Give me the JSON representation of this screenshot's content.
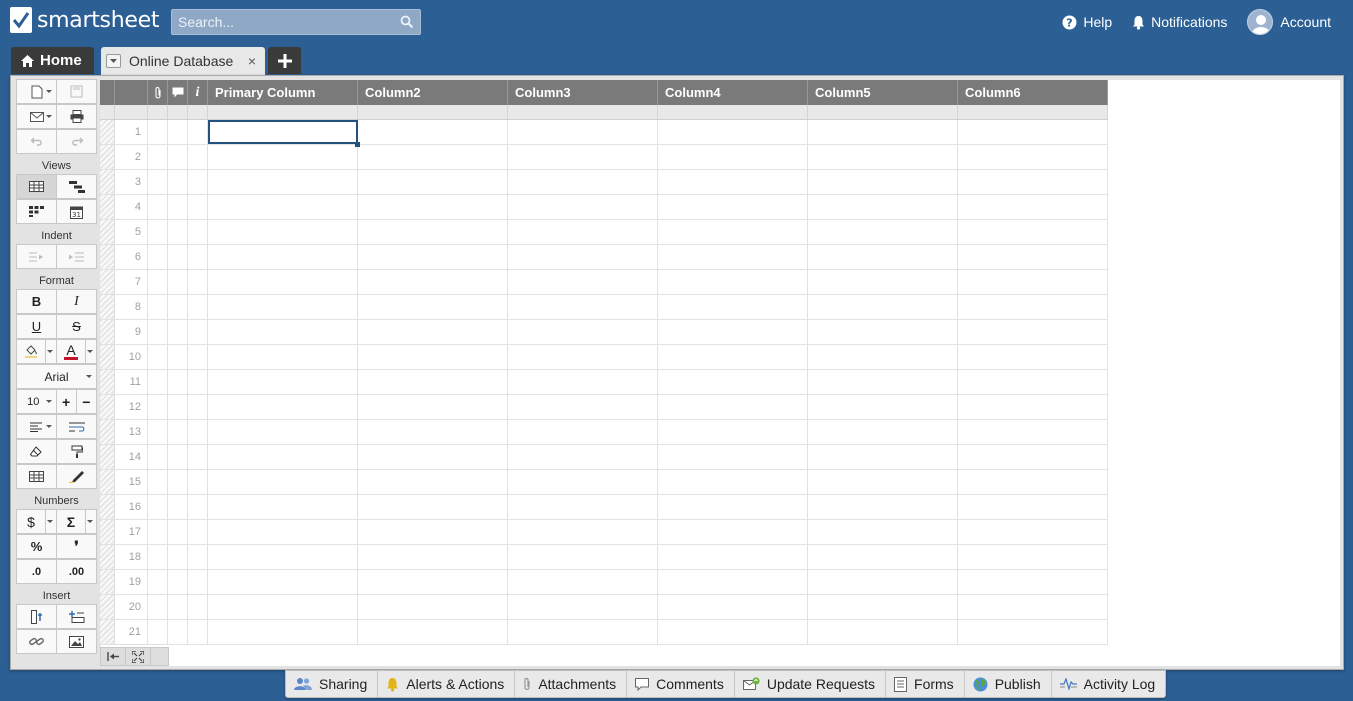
{
  "app": {
    "logo_text": "smartsheet"
  },
  "search": {
    "placeholder": "Search..."
  },
  "top_links": {
    "help": "Help",
    "notifications": "Notifications",
    "account": "Account"
  },
  "tabs": {
    "home": "Home",
    "sheet": "Online Database",
    "close": "×"
  },
  "toolbar": {
    "views_label": "Views",
    "indent_label": "Indent",
    "format_label": "Format",
    "numbers_label": "Numbers",
    "insert_label": "Insert",
    "bold": "B",
    "italic": "I",
    "underline": "U",
    "strike": "S",
    "text_color": "A",
    "font": "Arial",
    "font_size": "10",
    "size_up": "+",
    "size_down": "−",
    "currency": "$",
    "sum": "Σ",
    "percent": "%",
    "comma": "❜",
    "dec_less": ".0",
    "dec_more": ".00"
  },
  "grid": {
    "columns": [
      "Primary Column",
      "Column2",
      "Column3",
      "Column4",
      "Column5",
      "Column6"
    ],
    "info_header": "i",
    "rows": [
      "1",
      "2",
      "3",
      "4",
      "5",
      "6",
      "7",
      "8",
      "9",
      "10",
      "11",
      "12",
      "13",
      "14",
      "15",
      "16",
      "17",
      "18",
      "19",
      "20",
      "21"
    ]
  },
  "bottombar": {
    "sharing": "Sharing",
    "alerts": "Alerts & Actions",
    "attachments": "Attachments",
    "comments": "Comments",
    "update_requests": "Update Requests",
    "forms": "Forms",
    "publish": "Publish",
    "activity_log": "Activity Log"
  },
  "colors": {
    "header_bg": "#2c5f94",
    "grid_header": "#7a7a7a",
    "selection": "#23507d"
  }
}
